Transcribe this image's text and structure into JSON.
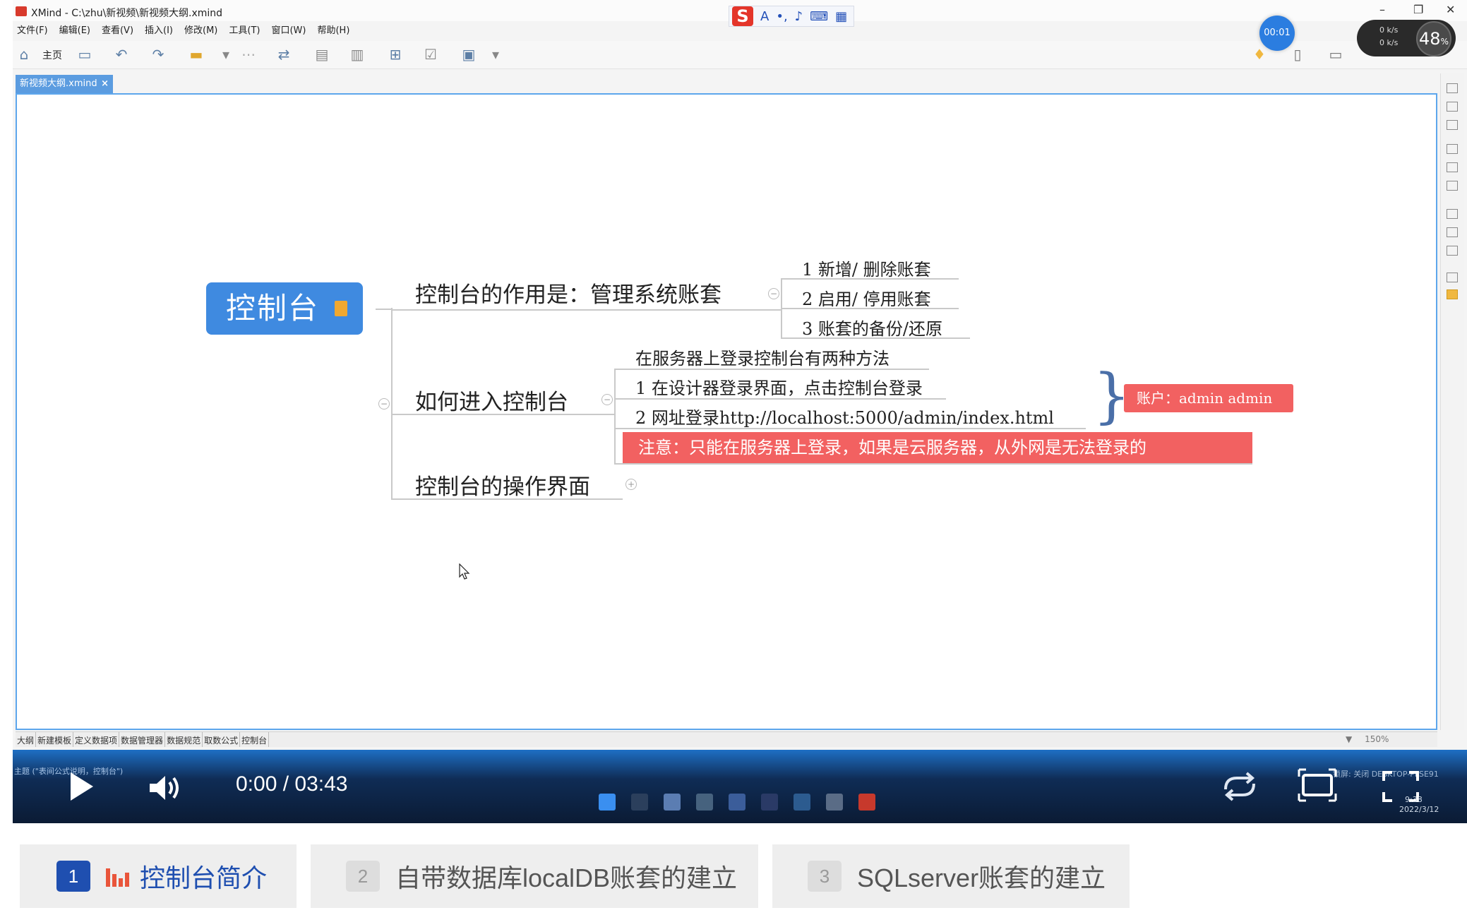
{
  "window": {
    "title": "XMind - C:\\zhu\\新视频\\新视频大纲.xmind"
  },
  "menu": [
    "文件(F)",
    "编辑(E)",
    "查看(V)",
    "插入(I)",
    "修改(M)",
    "工具(T)",
    "窗口(W)",
    "帮助(H)"
  ],
  "toolbar": {
    "home_label": "主页"
  },
  "overlays": {
    "timer": "00:01",
    "net_up": "0 k/s",
    "net_down": "0 k/s",
    "percent": "48",
    "percent_unit": "%"
  },
  "doc_tab": {
    "label": "新视频大纲.xmind",
    "close": "×"
  },
  "mindmap": {
    "central": "控制台",
    "branches": [
      {
        "label": "控制台的作用是：管理系统账套",
        "children": [
          "1 新增/ 删除账套",
          "2 启用/ 停用账套",
          "3 账套的备份/还原"
        ]
      },
      {
        "label": "如何进入控制台",
        "intro": "在服务器上登录控制台有两种方法",
        "children": [
          "1 在设计器登录界面，点击控制台登录",
          "2 网址登录http://localhost:5000/admin/index.html"
        ],
        "summary": "账户：admin admin",
        "note": "注意：只能在服务器上登录，如果是云服务器，从外网是无法登录的"
      },
      {
        "label": "控制台的操作界面"
      }
    ]
  },
  "sheet_tabs": [
    "大纲",
    "新建模板",
    "定义数据项",
    "数据管理器",
    "数据规范",
    "取数公式",
    "控制台"
  ],
  "zoom": "150%",
  "status_text": "主题 (\"表间公式说明，控制台\")",
  "player": {
    "time": "0:00 / 03:43"
  },
  "system": {
    "right_status": "锁屏: 关闭   DESKTOP-PLSE91",
    "clock_time": "9:38",
    "clock_date": "2022/3/12"
  },
  "chapters": [
    {
      "num": "1",
      "label": "控制台简介",
      "active": true
    },
    {
      "num": "2",
      "label": "自带数据库localDB账套的建立",
      "active": false
    },
    {
      "num": "3",
      "label": "SQLserver账套的建立",
      "active": false
    }
  ],
  "colors": {
    "central_node": "#3f8ae0",
    "highlight_box": "#f26161",
    "active_chapter": "#1f4fb0",
    "canvas_border": "#5da6ec"
  }
}
